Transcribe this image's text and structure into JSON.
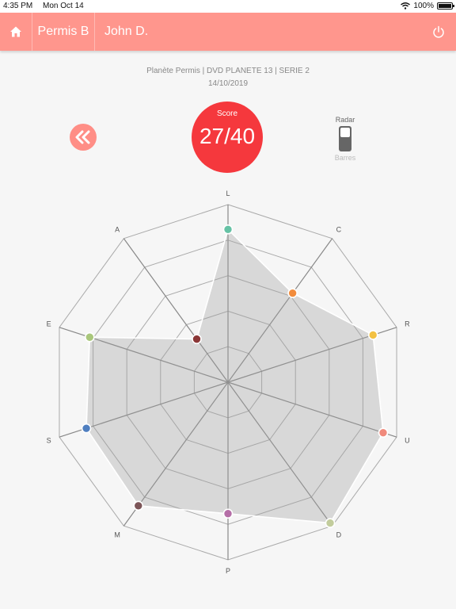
{
  "status_bar": {
    "time": "4:35 PM",
    "date": "Mon Oct 14",
    "battery": "100%"
  },
  "nav": {
    "category": "Permis B",
    "user": "John D."
  },
  "header": {
    "source": "Planète Permis | DVD PLANETE 13 | SERIE 2",
    "date": "14/10/2019"
  },
  "score": {
    "label": "Score",
    "value": "27/40"
  },
  "view_toggle": {
    "radar_label": "Radar",
    "bars_label": "Barres"
  },
  "icons": {
    "home": "home-icon",
    "back": "double-chevron-left-icon",
    "power": "power-icon",
    "wifi": "wifi-icon",
    "battery": "battery-icon"
  },
  "colors": {
    "accent": "#ff968d",
    "score": "#f5383d"
  },
  "chart_data": {
    "type": "radar",
    "max": 1,
    "axes": [
      {
        "label": "L",
        "value": 0.86,
        "color": "#66c2a5"
      },
      {
        "label": "C",
        "value": 0.62,
        "color": "#f28c3c"
      },
      {
        "label": "R",
        "value": 0.86,
        "color": "#f3c142"
      },
      {
        "label": "U",
        "value": 0.92,
        "color": "#f08a7c"
      },
      {
        "label": "D",
        "value": 0.98,
        "color": "#c2cc9c"
      },
      {
        "label": "P",
        "value": 0.74,
        "color": "#b56ea7"
      },
      {
        "label": "M",
        "value": 0.86,
        "color": "#7c5558"
      },
      {
        "label": "S",
        "value": 0.84,
        "color": "#4f7fc0"
      },
      {
        "label": "E",
        "value": 0.82,
        "color": "#a9c77c"
      },
      {
        "label": "A",
        "value": 0.3,
        "color": "#8b3737"
      }
    ]
  }
}
